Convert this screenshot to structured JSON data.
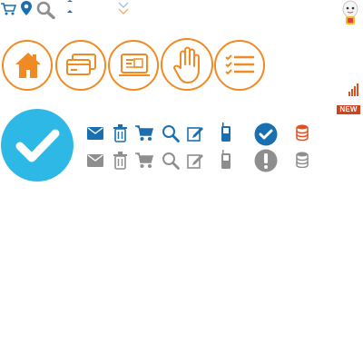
{
  "colors": {
    "orange": "#f08a24",
    "blue": "#1a6fb0",
    "sky": "#2eb8e6",
    "gray": "#8e8e8e",
    "red_badge": "#d0431f"
  },
  "top_icons": [
    "cart-icon",
    "map-pin-icon",
    "search-icon",
    "sort-arrows-icon",
    "double-chevron-down-icon",
    "mascot-icon"
  ],
  "circle_icons": [
    "home-icon",
    "cards-icon",
    "news-icon",
    "hand-stop-icon",
    "checklist-icon"
  ],
  "badge": {
    "new_label": "NEW"
  },
  "small_icon_row_colored": [
    "mail-icon",
    "trash-icon",
    "cart-icon",
    "search-icon",
    "edit-icon",
    "phone-icon",
    "check-circle-icon",
    "database-icon"
  ],
  "small_icon_row_gray": [
    "mail-icon",
    "trash-icon",
    "cart-icon",
    "search-icon",
    "edit-icon",
    "phone-icon",
    "alert-circle-icon",
    "database-icon"
  ]
}
